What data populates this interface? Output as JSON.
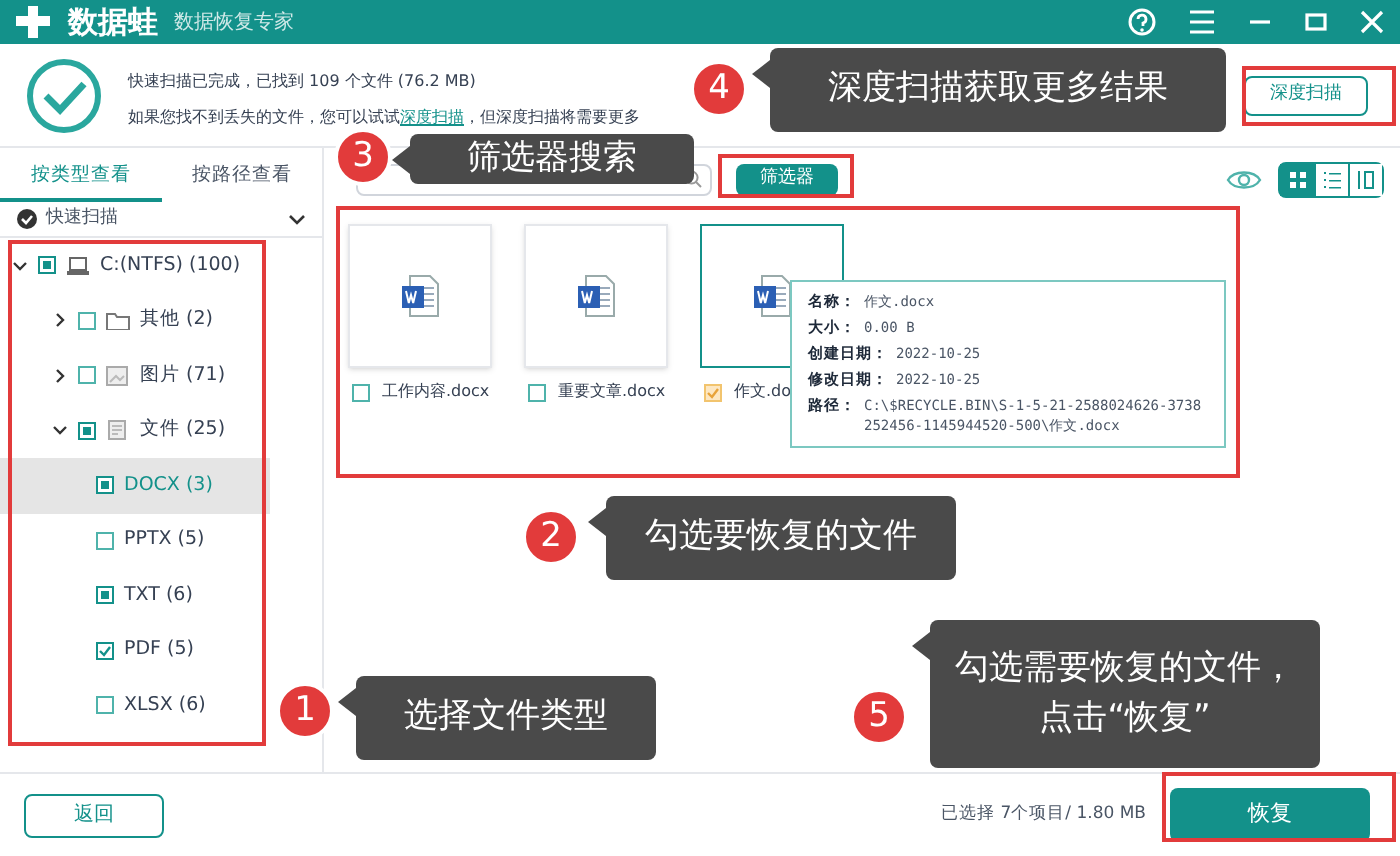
{
  "app": {
    "title": "数据蛙",
    "subtitle": "数据恢复专家"
  },
  "scan_summary": {
    "line1": "快速扫描已完成，已找到 109 个文件 (76.2 MB)",
    "line2_before": "如果您找不到丢失的文件，您可以试试",
    "link": "深度扫描",
    "line2_after": "，但深度扫描将需要更多"
  },
  "deep_scan_button": "深度扫描",
  "view_tabs": [
    {
      "label": "按类型查看",
      "selected": true
    },
    {
      "label": "按路径查看",
      "selected": false
    }
  ],
  "scan_mode": {
    "label": "快速扫描"
  },
  "tree": [
    {
      "label": "C:(NTFS) (100)",
      "kind": "drive",
      "checked": false,
      "partial": true,
      "expanded": true,
      "selected": false,
      "children": [
        {
          "label": "其他 (2)",
          "kind": "folder",
          "checked": false,
          "partial": false,
          "expanded": false,
          "selected": false
        },
        {
          "label": "图片 (71)",
          "kind": "image",
          "checked": false,
          "partial": false,
          "expanded": false,
          "selected": false
        },
        {
          "label": "文件 (25)",
          "kind": "document",
          "checked": false,
          "partial": true,
          "expanded": true,
          "selected": false,
          "children": [
            {
              "label": "DOCX (3)",
              "checked": false,
              "partial": true,
              "selected": true
            },
            {
              "label": "PPTX (5)",
              "checked": false,
              "partial": false,
              "selected": false
            },
            {
              "label": "TXT (6)",
              "checked": false,
              "partial": true,
              "selected": false
            },
            {
              "label": "PDF (5)",
              "checked": true,
              "partial": false,
              "selected": false
            },
            {
              "label": "XLSX (6)",
              "checked": false,
              "partial": false,
              "selected": false
            }
          ]
        }
      ]
    }
  ],
  "filter_button": "筛选器",
  "view_modes": [
    {
      "kind": "grid",
      "selected": true
    },
    {
      "kind": "list",
      "selected": false
    },
    {
      "kind": "columns",
      "selected": false
    }
  ],
  "files": [
    {
      "name": "工作内容.docx",
      "checked": false,
      "selected": false
    },
    {
      "name": "重要文章.docx",
      "checked": false,
      "selected": false
    },
    {
      "name": "作文.do",
      "checked": true,
      "selected": true
    }
  ],
  "tooltip": [
    {
      "label": "名称：",
      "value": "作文.docx"
    },
    {
      "label": "大小：",
      "value": "0.00 B"
    },
    {
      "label": "创建日期：",
      "value": "2022-10-25"
    },
    {
      "label": "修改日期：",
      "value": "2022-10-25"
    },
    {
      "label": "路径：",
      "value": "C:\\$RECYCLE.BIN\\S-1-5-21-2588024626-3738252456-1145944520-500\\作文.docx"
    }
  ],
  "footer": {
    "back_button": "返回",
    "selection_info": "已选择 7个项目/ 1.80 MB",
    "recover_button": "恢复"
  },
  "callouts": [
    {
      "number": "1",
      "lines": [
        "选择文件类型"
      ]
    },
    {
      "number": "2",
      "lines": [
        "勾选要恢复的文件"
      ]
    },
    {
      "number": "3",
      "lines": [
        "筛选器搜索"
      ]
    },
    {
      "number": "4",
      "lines": [
        "深度扫描获取更多结果"
      ]
    },
    {
      "number": "5",
      "lines": [
        "勾选需要恢复的文件，",
        "点击“恢复”"
      ]
    }
  ]
}
